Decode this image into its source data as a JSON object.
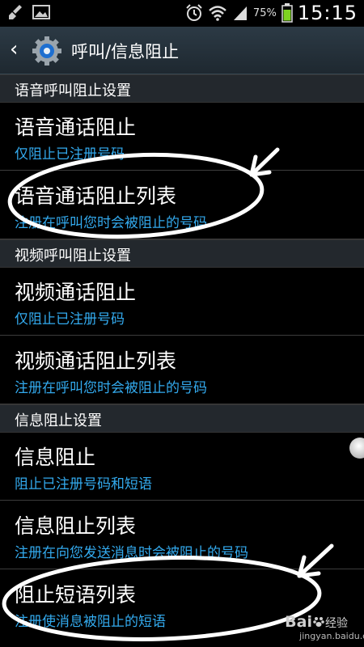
{
  "status": {
    "battery_percent": "75%",
    "time": "15:15",
    "left_icons": [
      "broom-icon",
      "image-icon"
    ],
    "right_icons": [
      "alarm-icon",
      "wifi-icon",
      "signal-icon",
      "battery-icon"
    ]
  },
  "header": {
    "title": "呼叫/信息阻止",
    "icons": [
      "back-arrow-icon",
      "settings-gear-icon"
    ]
  },
  "sections": [
    {
      "label": "语音呼叫阻止设置"
    },
    {
      "label": "视频呼叫阻止设置"
    },
    {
      "label": "信息阻止设置"
    }
  ],
  "items": [
    {
      "title": "语音通话阻止",
      "subtitle": "仅阻止已注册号码"
    },
    {
      "title": "语音通话阻止列表",
      "subtitle": "注册在呼叫您时会被阻止的号码"
    },
    {
      "title": "视频通话阻止",
      "subtitle": "仅阻止已注册号码"
    },
    {
      "title": "视频通话阻止列表",
      "subtitle": "注册在呼叫您时会被阻止的号码"
    },
    {
      "title": "信息阻止",
      "subtitle": "阻止已注册号码和短语"
    },
    {
      "title": "信息阻止列表",
      "subtitle": "注册在向您发送消息时会被阻止的号码"
    },
    {
      "title": "阻止短语列表",
      "subtitle": "注册使消息被阻止的短语"
    }
  ],
  "watermark": {
    "brand": "Bai",
    "brand2": "经验",
    "url": "jingyan.baidu.com"
  },
  "colors": {
    "subtitle": "#33aaee",
    "section_bg": "#23282d",
    "actionbar": "#26323b"
  }
}
